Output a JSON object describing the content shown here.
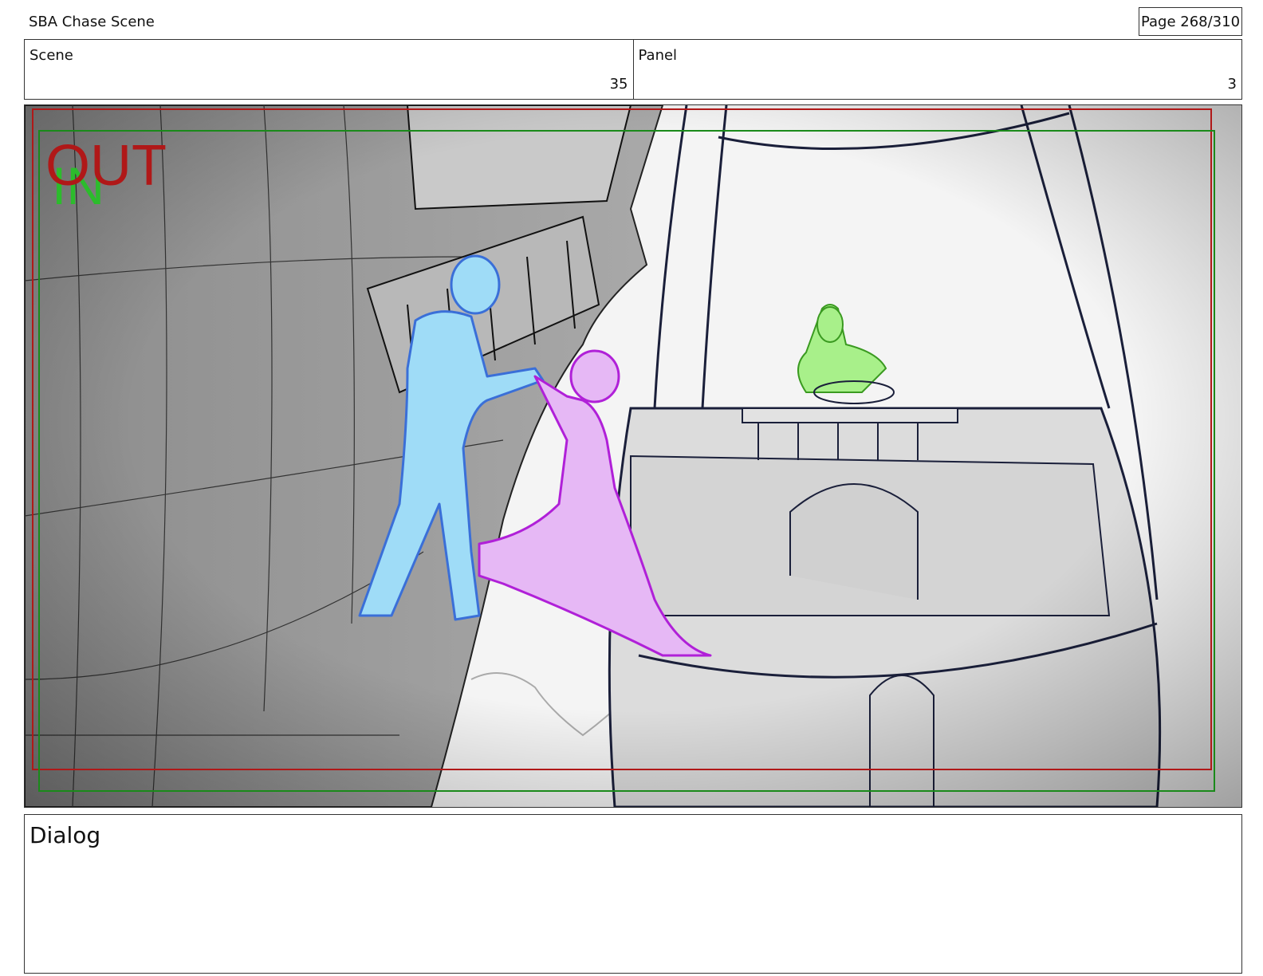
{
  "header": {
    "document_title": "SBA Chase Scene",
    "page_counter": "Page 268/310"
  },
  "info": {
    "scene_label": "Scene",
    "scene_value": "35",
    "panel_label": "Panel",
    "panel_value": "3"
  },
  "panel": {
    "out_label": "OUT",
    "in_label": "IN",
    "colors": {
      "out_frame": "#b01818",
      "in_frame": "#1a8a1a",
      "man": "#9fdcf7",
      "man_line": "#3a6fd8",
      "woman": "#e6b8f5",
      "woman_line": "#b020d8",
      "helmsman": "#a8f08a",
      "helmsman_line": "#3a9a20",
      "ink": "#1a1f3a"
    }
  },
  "dialog": {
    "label": "Dialog"
  }
}
